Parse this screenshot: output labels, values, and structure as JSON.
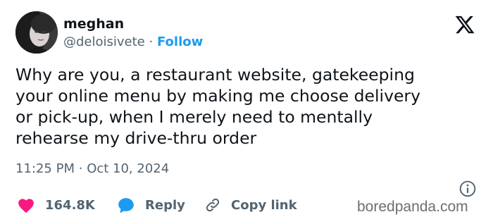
{
  "user": {
    "display_name": "meghan",
    "handle": "@deloisivete",
    "separator": "·",
    "follow_label": "Follow"
  },
  "tweet": {
    "lines": [
      "Why are you, a restaurant website, gatekeeping",
      "your online menu by making me choose delivery",
      "or pick-up, when I merely need to mentally",
      "rehearse my drive-thru order"
    ],
    "time": "11:25 PM",
    "date_separator": "·",
    "date": "Oct 10, 2024"
  },
  "actions": {
    "like_count": "164.8K",
    "reply_label": "Reply",
    "copy_link_label": "Copy link"
  },
  "icons": {
    "brand": "x-logo-icon",
    "info": "info-icon",
    "like": "heart-icon",
    "reply": "speech-bubble-icon",
    "copy": "link-icon"
  },
  "colors": {
    "text": "#0f1419",
    "secondary": "#536471",
    "accent": "#1d9bf0",
    "like": "#f91880",
    "watermark": "#6e6e6e"
  },
  "watermark": "boredpanda.com"
}
